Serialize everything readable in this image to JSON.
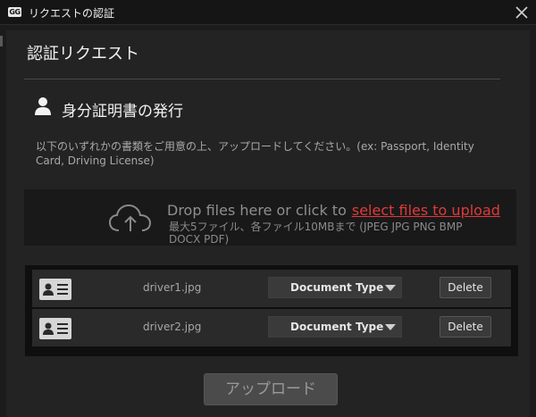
{
  "window": {
    "logo_text": "GG",
    "title": "リクエストの認証"
  },
  "dialog": {
    "heading": "認証リクエスト",
    "section_title": "身分証明書の発行",
    "instructions": "以下のいずれかの書類をご用意の上、アップロードしてください。(ex: Passport, Identity Card, Driving License)"
  },
  "dropzone": {
    "prompt": "Drop files here or click to",
    "link_label": "select files to upload",
    "limits": "最大5ファイル、各ファイル10MBまで (JPEG JPG PNG BMP DOCX PDF)"
  },
  "files": [
    {
      "name": "driver1.jpg",
      "doc_type": "Document Type",
      "delete_label": "Delete"
    },
    {
      "name": "driver2.jpg",
      "doc_type": "Document Type",
      "delete_label": "Delete"
    }
  ],
  "upload_button": "アップロード",
  "icons": [
    "app-logo-icon",
    "close-icon",
    "person-icon",
    "cloud-upload-icon",
    "id-card-icon",
    "caret-down-icon"
  ],
  "colors": {
    "accent_link": "#e2393b",
    "background": "#1c1c1c",
    "panel": "#232323"
  }
}
